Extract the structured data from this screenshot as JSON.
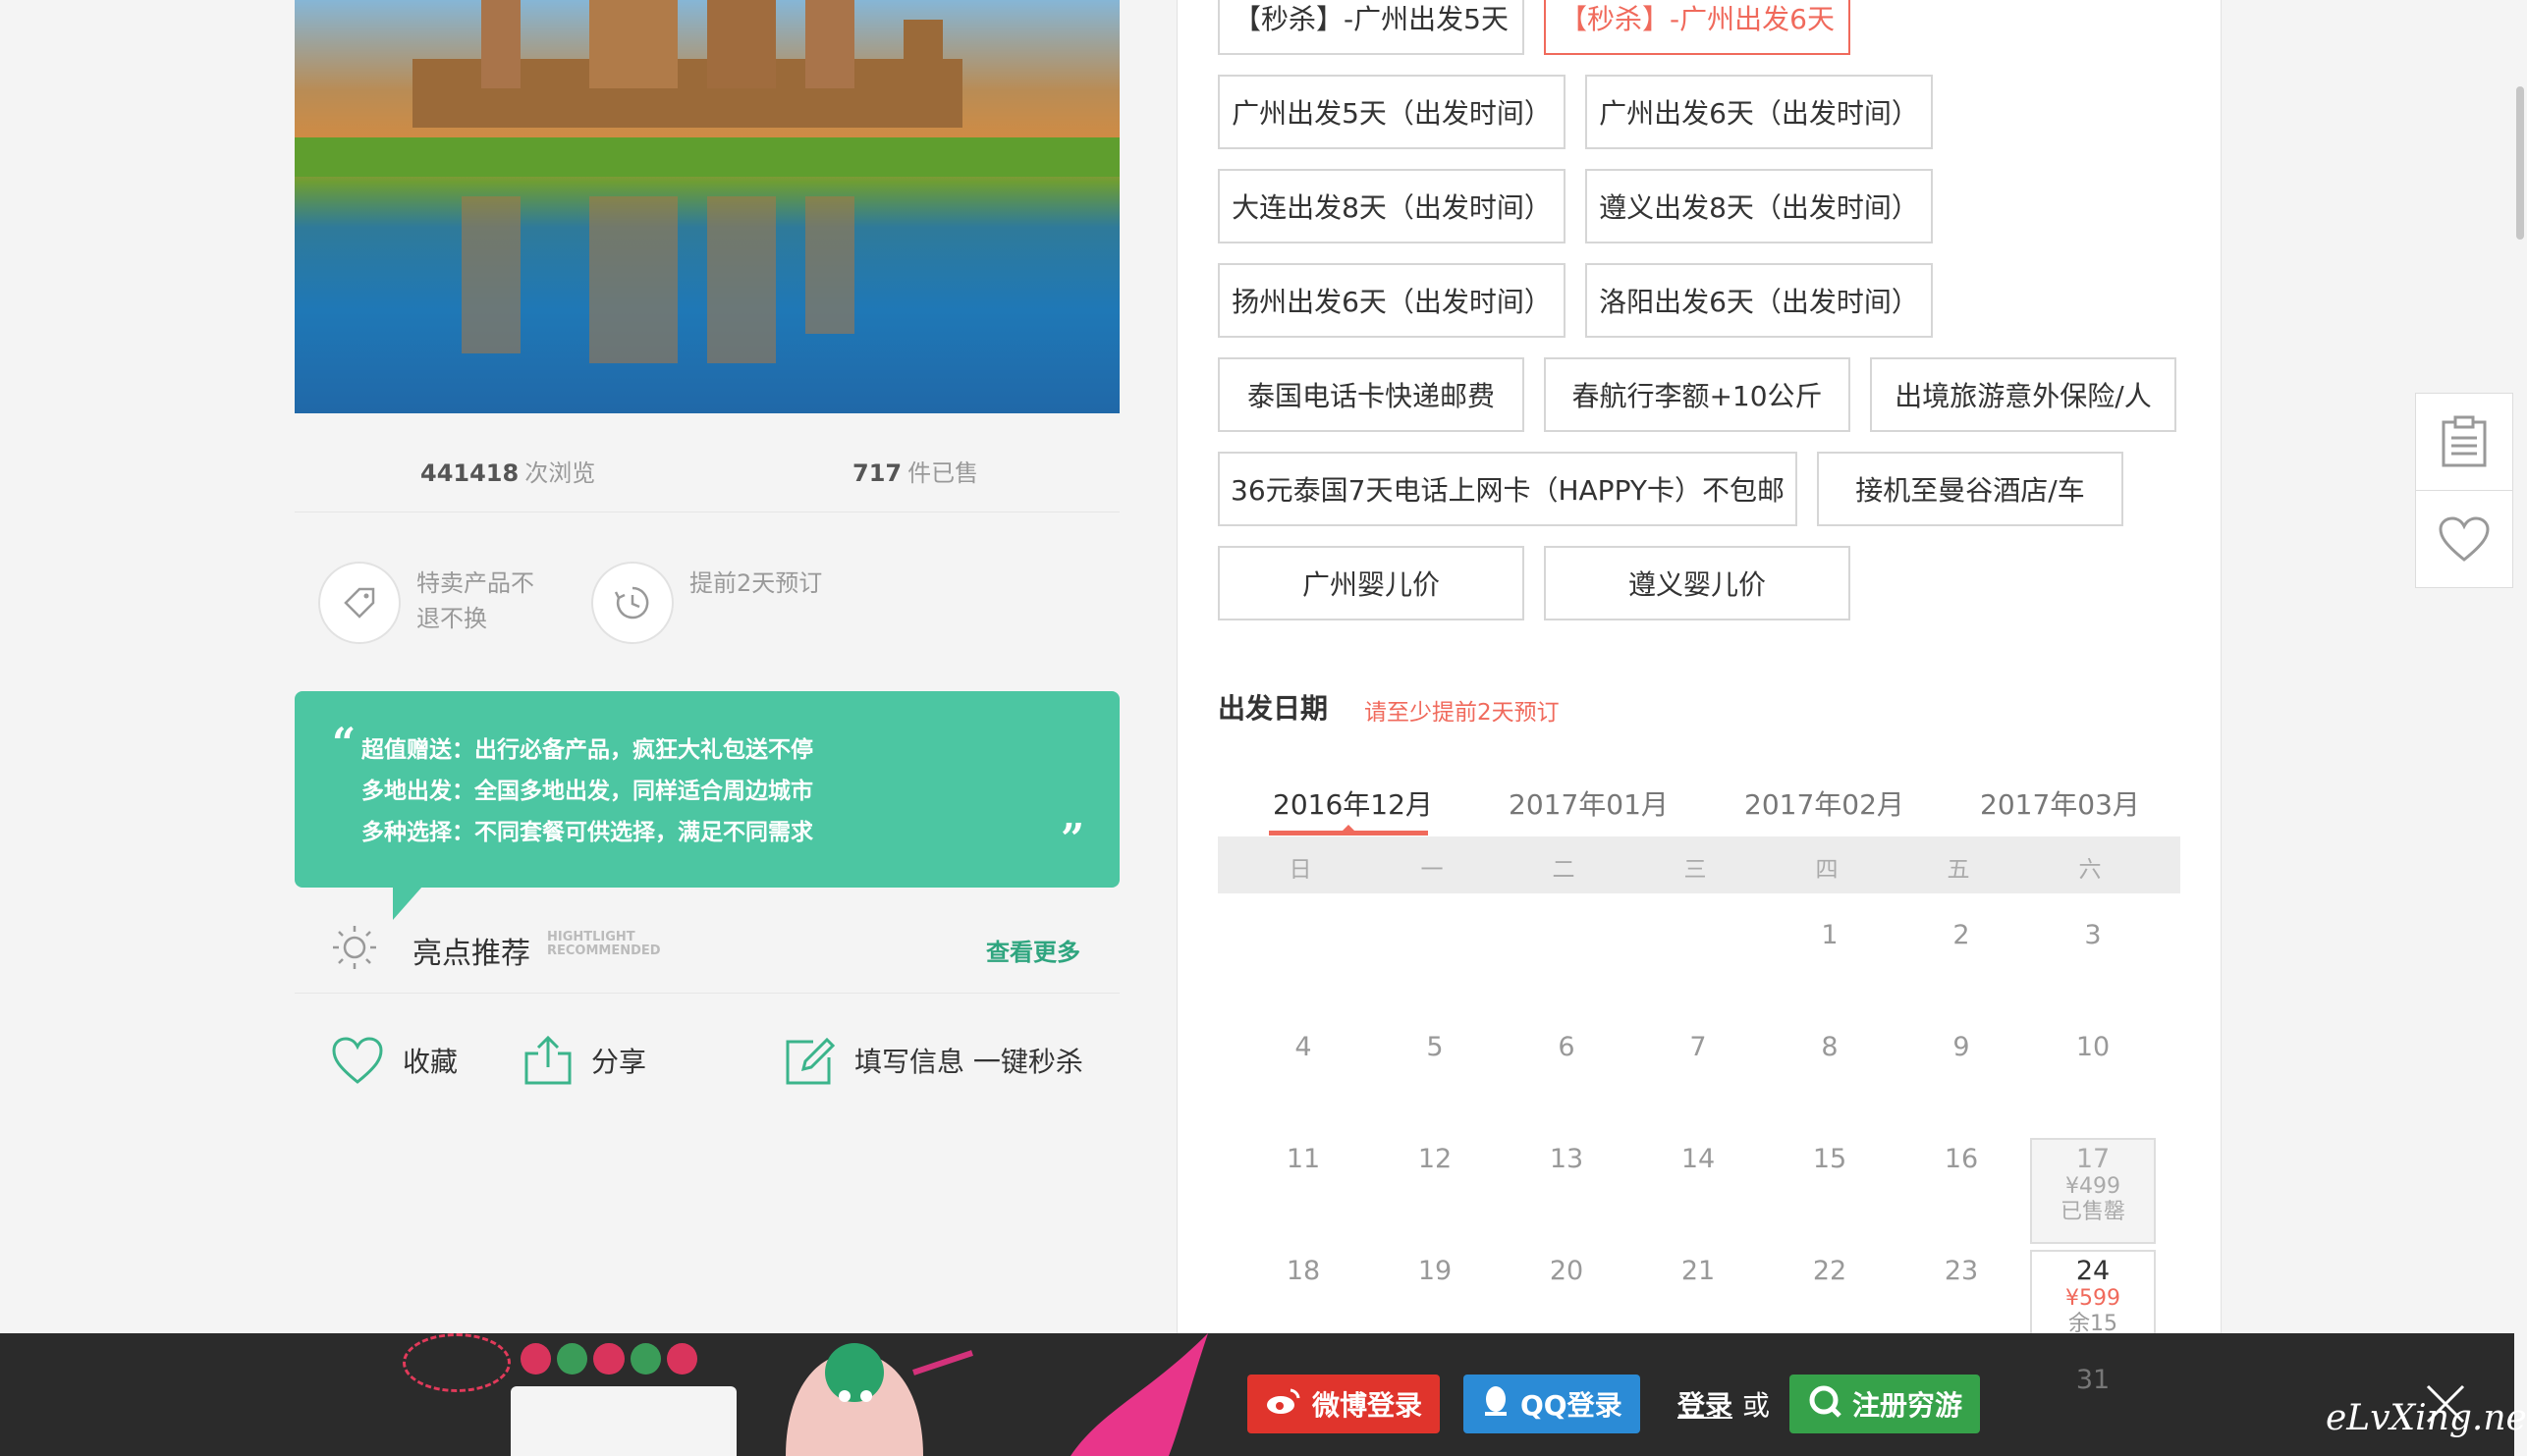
{
  "stats": {
    "views_number": "441418",
    "views_label": "次浏览",
    "sold_number": "717",
    "sold_label": "件已售"
  },
  "promises": [
    {
      "icon": "tag-icon",
      "text": "特卖产品不退不换"
    },
    {
      "icon": "clock-icon",
      "text": "提前2天预订"
    }
  ],
  "highlight_quote": {
    "lines": [
      "超值赠送：出行必备产品，疯狂大礼包送不停",
      "多地出发：全国多地出发，同样适合周边城市",
      "多种选择：不同套餐可供选择，满足不同需求"
    ]
  },
  "highlight": {
    "title": "亮点推荐",
    "subtitle_line1": "HIGHTLIGHT",
    "subtitle_line2": "RECOMMENDED",
    "more": "查看更多"
  },
  "actions": {
    "favorite": "收藏",
    "share": "分享",
    "flash": "填写信息 一键秒杀"
  },
  "options": [
    "【秒杀】-广州出发5天",
    "【秒杀】-广州出发6天",
    "广州出发5天（出发时间）",
    "广州出发6天（出发时间）",
    "大连出发8天（出发时间）",
    "遵义出发8天（出发时间）",
    "扬州出发6天（出发时间）",
    "洛阳出发6天（出发时间）",
    "泰国电话卡快递邮费",
    "春航行李额+10公斤",
    "出境旅游意外保险/人",
    "36元泰国7天电话上网卡（HAPPY卡）不包邮",
    "接机至曼谷酒店/车",
    "广州婴儿价",
    "遵义婴儿价"
  ],
  "selected_option": "【秒杀】-广州出发6天",
  "departure": {
    "title": "出发日期",
    "note": "请至少提前2天预订"
  },
  "months": [
    "2016年12月",
    "2017年01月",
    "2017年02月",
    "2017年03月"
  ],
  "active_month": "2016年12月",
  "weekdays": [
    "日",
    "一",
    "二",
    "三",
    "四",
    "五",
    "六"
  ],
  "days": {
    "row1": [
      "1",
      "2",
      "3"
    ],
    "row2": [
      "4",
      "5",
      "6",
      "7",
      "8",
      "9",
      "10"
    ],
    "row3": [
      "11",
      "12",
      "13",
      "14",
      "15",
      "16"
    ],
    "row4": [
      "18",
      "19",
      "20",
      "21",
      "22",
      "23"
    ],
    "day17": {
      "day": "17",
      "price": "¥499",
      "status": "已售罄"
    },
    "day24": {
      "day": "24",
      "price": "¥599",
      "status": "余15"
    },
    "day31": "31"
  },
  "banner": {
    "weibo": "微博登录",
    "qq": "QQ登录",
    "login": "登录",
    "or": "或",
    "register": "注册穷游",
    "watermark": "eLvXing.net"
  },
  "colors": {
    "accent": "#f06a5c",
    "green": "#4cc6a2",
    "link_green": "#2fa57f",
    "weibo": "#e0342c",
    "qq": "#2b8bd6",
    "register": "#36a24a"
  }
}
